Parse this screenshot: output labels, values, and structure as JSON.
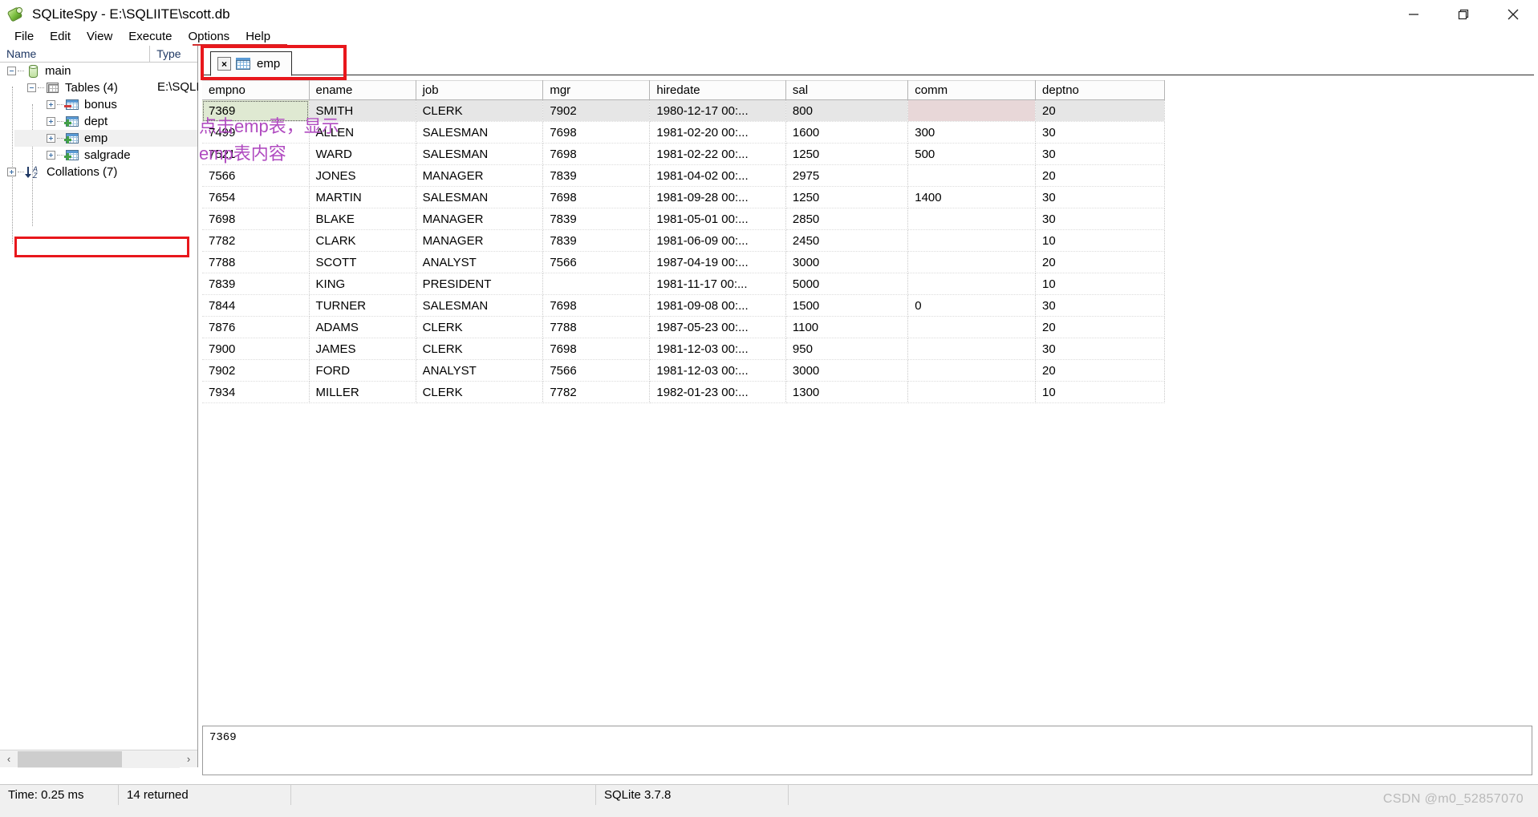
{
  "window": {
    "title": "SQLiteSpy - E:\\SQLIITE\\scott.db",
    "app_icon": "sqlitespy-logo-icon",
    "controls": {
      "minimize": "minimize-icon",
      "restore": "restore-icon",
      "close": "close-icon"
    }
  },
  "menubar": {
    "items": [
      {
        "label": "File"
      },
      {
        "label": "Edit"
      },
      {
        "label": "View"
      },
      {
        "label": "Execute"
      },
      {
        "label": "Options"
      },
      {
        "label": "Help"
      }
    ]
  },
  "tree": {
    "columns": {
      "name": "Name",
      "type": "Type"
    },
    "type_value": "E:\\SQLI",
    "items": [
      {
        "label": "main",
        "icon": "database-icon",
        "state": "expanded",
        "indent": 0
      },
      {
        "label": "Tables (4)",
        "icon": "tables-icon",
        "state": "expanded",
        "indent": 1
      },
      {
        "label": "bonus",
        "icon": "table-minus-icon",
        "state": "collapsed",
        "indent": 2
      },
      {
        "label": "dept",
        "icon": "table-plus-icon",
        "state": "collapsed",
        "indent": 2
      },
      {
        "label": "emp",
        "icon": "table-plus-icon",
        "state": "collapsed",
        "indent": 2,
        "selected": true
      },
      {
        "label": "salgrade",
        "icon": "table-plus-icon",
        "state": "collapsed",
        "indent": 2
      },
      {
        "label": "Collations (7)",
        "icon": "collations-az-icon",
        "state": "collapsed",
        "indent": 0
      }
    ],
    "hscroll": {
      "left_arrow": "‹",
      "right_arrow": "›"
    }
  },
  "tabs": [
    {
      "label": "emp",
      "close_label": "×",
      "icon": "table-grid-icon",
      "active": true
    }
  ],
  "annotations": [
    {
      "text": "点击emp表，显示",
      "color": "#b04bc0"
    },
    {
      "text": "emp表内容",
      "color": "#b04bc0"
    }
  ],
  "grid": {
    "columns": [
      "empno",
      "ename",
      "job",
      "mgr",
      "hiredate",
      "sal",
      "comm",
      "deptno"
    ],
    "rows": [
      {
        "empno": "7369",
        "ename": "SMITH",
        "job": "CLERK",
        "mgr": "7902",
        "hiredate": "1980-12-17 00:...",
        "sal": "800",
        "comm": "",
        "deptno": "20",
        "selected": true
      },
      {
        "empno": "7499",
        "ename": "ALLEN",
        "job": "SALESMAN",
        "mgr": "7698",
        "hiredate": "1981-02-20 00:...",
        "sal": "1600",
        "comm": "300",
        "deptno": "30"
      },
      {
        "empno": "7521",
        "ename": "WARD",
        "job": "SALESMAN",
        "mgr": "7698",
        "hiredate": "1981-02-22 00:...",
        "sal": "1250",
        "comm": "500",
        "deptno": "30"
      },
      {
        "empno": "7566",
        "ename": "JONES",
        "job": "MANAGER",
        "mgr": "7839",
        "hiredate": "1981-04-02 00:...",
        "sal": "2975",
        "comm": "",
        "deptno": "20"
      },
      {
        "empno": "7654",
        "ename": "MARTIN",
        "job": "SALESMAN",
        "mgr": "7698",
        "hiredate": "1981-09-28 00:...",
        "sal": "1250",
        "comm": "1400",
        "deptno": "30"
      },
      {
        "empno": "7698",
        "ename": "BLAKE",
        "job": "MANAGER",
        "mgr": "7839",
        "hiredate": "1981-05-01 00:...",
        "sal": "2850",
        "comm": "",
        "deptno": "30"
      },
      {
        "empno": "7782",
        "ename": "CLARK",
        "job": "MANAGER",
        "mgr": "7839",
        "hiredate": "1981-06-09 00:...",
        "sal": "2450",
        "comm": "",
        "deptno": "10"
      },
      {
        "empno": "7788",
        "ename": "SCOTT",
        "job": "ANALYST",
        "mgr": "7566",
        "hiredate": "1987-04-19 00:...",
        "sal": "3000",
        "comm": "",
        "deptno": "20"
      },
      {
        "empno": "7839",
        "ename": "KING",
        "job": "PRESIDENT",
        "mgr": "",
        "hiredate": "1981-11-17 00:...",
        "sal": "5000",
        "comm": "",
        "deptno": "10"
      },
      {
        "empno": "7844",
        "ename": "TURNER",
        "job": "SALESMAN",
        "mgr": "7698",
        "hiredate": "1981-09-08 00:...",
        "sal": "1500",
        "comm": "0",
        "deptno": "30"
      },
      {
        "empno": "7876",
        "ename": "ADAMS",
        "job": "CLERK",
        "mgr": "7788",
        "hiredate": "1987-05-23 00:...",
        "sal": "1100",
        "comm": "",
        "deptno": "20"
      },
      {
        "empno": "7900",
        "ename": "JAMES",
        "job": "CLERK",
        "mgr": "7698",
        "hiredate": "1981-12-03 00:...",
        "sal": "950",
        "comm": "",
        "deptno": "30"
      },
      {
        "empno": "7902",
        "ename": "FORD",
        "job": "ANALYST",
        "mgr": "7566",
        "hiredate": "1981-12-03 00:...",
        "sal": "3000",
        "comm": "",
        "deptno": "20"
      },
      {
        "empno": "7934",
        "ename": "MILLER",
        "job": "CLERK",
        "mgr": "7782",
        "hiredate": "1982-01-23 00:...",
        "sal": "1300",
        "comm": "",
        "deptno": "10"
      }
    ]
  },
  "editor": {
    "value": "7369"
  },
  "statusbar": {
    "time": "Time: 0.25 ms",
    "returned": "14 returned",
    "middle": "",
    "version": "SQLite 3.7.8",
    "rest": ""
  },
  "watermark": "CSDN @m0_52857070",
  "colors": {
    "annotation": "#b04bc0",
    "highlight_box": "#e8171c",
    "menu_underline": "#d32f2f",
    "key_column": "#edf7e0",
    "value_column": "#f1f9e6",
    "null_cell": "#fbe0e2",
    "selected_row": "#e6e6e6"
  }
}
